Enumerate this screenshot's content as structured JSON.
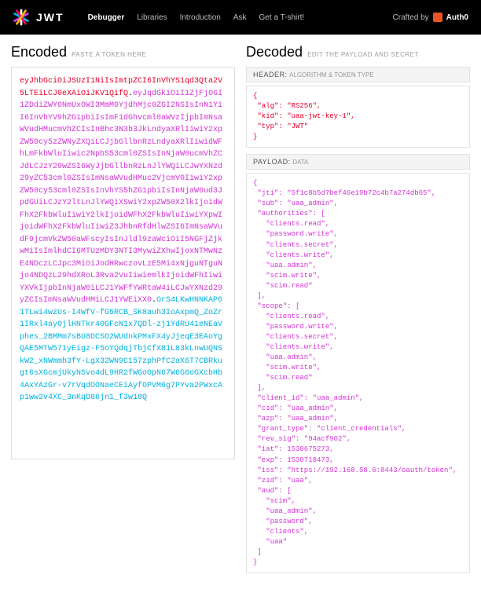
{
  "nav": {
    "brand": "JWT",
    "links": [
      "Debugger",
      "Libraries",
      "Introduction",
      "Ask",
      "Get a T-shirt!"
    ],
    "active_index": 0,
    "crafted_prefix": "Crafted by",
    "crafted_brand": "Auth0"
  },
  "encoded": {
    "title": "Encoded",
    "subtitle": "PASTE A TOKEN HERE",
    "header_seg": "eyJhbGciOiJSUzI1NiIsImtpZCI6InVhYS1qd3Qta2V5LTEiLCJ0eXAiOiJKV1QifQ",
    "payload_seg": "eyJqdGkiOiI1ZjFjOGI1ZDdiZWY0NmUxOWI3MmM0YjdhMjc0ZGI2NSIsInN1YiI6InVhYV9hZG1pbiIsImF1dGhvcml0aWVzIjpbImNsaWVudHMucmVhZCIsInBhc3N3b3JkLndyaXRlIiwiY2xpZW50cy5zZWNyZXQiLCJjbGllbnRzLndyaXRlIiwidWFhLmFkbWluIiwic2NpbS53cml0ZSIsInNjaW0ucmVhZCJdLCJzY29wZSI6WyJjbGllbnRzLnJlYWQiLCJwYXNzd29yZC53cml0ZSIsImNsaWVudHMuc2VjcmV0IiwiY2xpZW50cy53cml0ZSIsInVhYS5hZG1pbiIsInNjaW0ud3JpdGUiLCJzY2ltLnJlYWQiXSwiY2xpZW50X2lkIjoidWFhX2FkbWluIiwiY2lkIjoidWFhX2FkbWluIiwiYXpwIjoidWFhX2FkbWluIiwiZ3JhbnRfdHlwZSI6ImNsaWVudF9jcmVkZW50aWFscyIsInJldl9zaWciOiI5NGFjZjkwMiIsImlhdCI6MTUzMDY3NTI3MywiZXhwIjoxNTMwNzE4NDczLCJpc3MiOiJodHRwczovLzE5Mi4xNjguNTguNjo4NDQzL29hdXRoL3Rva2VuIiwiemlkIjoidWFhIiwiYXVkIjpbInNjaW0iLCJ1YWFfYWRtaW4iLCJwYXNzd29yZCIsImNsaWVudHMiLCJ1YWEiXX0",
    "sig_seg": "OrS4LKwHNNKAP61TLwi4wzUs-I4WfV-fG5RCB_SK8auh3IoAxpmQ_ZoZr1IRxl4ayOjlHNTkr40GFcN1x7QDl-zj1YdRU41eNEaVphes_2BMMm7sBU8DCSO2WUdnkPMxFX4yJjeqE3EAoYgQAE5MTW571yEigz-F5oYQdqjTbjCfX81L83kLnwUQNSkW2_xNWmmh3fY-LgX32WN9C157zphPfC2aX6T7CBRkugt6sXGcmjUkyNSvo4dL9HR2fWGoOpN67W6G6oGXcbHb4AxYAzGr-v7rVqdOONaeCEiAyfOPVM6g7PYva2PWxcAp1ww2v4XC_3nKqD86jn1_f3w18Q"
  },
  "decoded": {
    "title": "Decoded",
    "subtitle": "EDIT THE PAYLOAD AND SECRET",
    "header_section": {
      "label": "HEADER:",
      "desc": "ALGORITHM & TOKEN TYPE"
    },
    "header_json": "{\n \"alg\": \"RS256\",\n \"kid\": \"uaa-jwt-key-1\",\n \"typ\": \"JWT\"\n}",
    "payload_section": {
      "label": "PAYLOAD:",
      "desc": "DATA"
    },
    "payload_json": "{\n \"jti\": \"5f1c8b5d7bef46e19b72c4b7a274db65\",\n \"sub\": \"uaa_admin\",\n \"authorities\": [\n   \"clients.read\",\n   \"password.write\",\n   \"clients.secret\",\n   \"clients.write\",\n   \"uaa.admin\",\n   \"scim.write\",\n   \"scim.read\"\n ],\n \"scope\": [\n   \"clients.read\",\n   \"password.write\",\n   \"clients.secret\",\n   \"clients.write\",\n   \"uaa.admin\",\n   \"scim.write\",\n   \"scim.read\"\n ],\n \"client_id\": \"uaa_admin\",\n \"cid\": \"uaa_admin\",\n \"azp\": \"uaa_admin\",\n \"grant_type\": \"client_credentials\",\n \"rev_sig\": \"94acf902\",\n \"iat\": 1530675273,\n \"exp\": 1530718473,\n \"iss\": \"https://192.168.58.6:8443/oauth/token\",\n \"zid\": \"uaa\",\n \"aud\": [\n   \"scim\",\n   \"uaa_admin\",\n   \"password\",\n   \"clients\",\n   \"uaa\"\n ]\n}"
  }
}
